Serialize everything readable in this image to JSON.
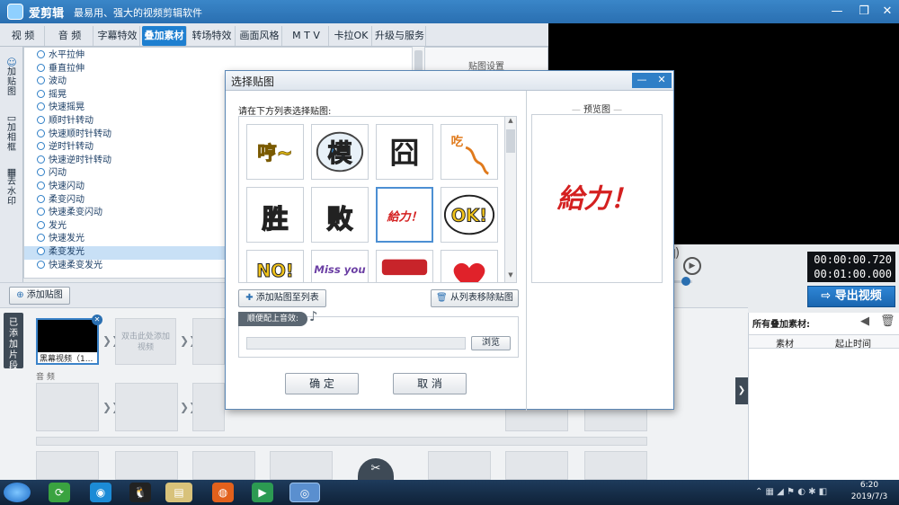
{
  "app": {
    "title": "爱剪辑",
    "subtitle": "最易用、强大的视频剪辑软件"
  },
  "window_controls": {
    "minimize": "—",
    "restore": "❐",
    "close": "✕"
  },
  "tabs": [
    {
      "label": "视 频"
    },
    {
      "label": "音 频"
    },
    {
      "label": "字幕特效"
    },
    {
      "label": "叠加素材",
      "active": true
    },
    {
      "label": "转场特效"
    },
    {
      "label": "画面风格"
    },
    {
      "label": "M T V"
    },
    {
      "label": "卡拉OK"
    },
    {
      "label": "升级与服务"
    }
  ],
  "left_tabs": [
    {
      "label": "加贴图"
    },
    {
      "label": "加相框"
    },
    {
      "label": "去水印"
    }
  ],
  "effects": [
    "水平拉伸",
    "垂直拉伸",
    "波动",
    "摇晃",
    "快速摇晃",
    "顺时针转动",
    "快速顺时针转动",
    "逆时针转动",
    "快速逆时针转动",
    "闪动",
    "快速闪动",
    "柔变闪动",
    "快速柔变闪动",
    "发光",
    "快速发光",
    "柔变发光",
    "快速柔变发光"
  ],
  "selected_effect": "柔变发光",
  "settings_panel": {
    "title": "贴图设置"
  },
  "add_sticker_button": "添加贴图",
  "player": {
    "time_current": "00:00:00.720",
    "time_total": "00:01:00.000"
  },
  "export_button": "导出视频",
  "timeline": {
    "added_tab": "已添加片段",
    "clip_label": "黑幕视频（1...",
    "add_video_hint": "双击此处添加视频",
    "audio_label": "音 频"
  },
  "right_panel": {
    "title": "所有叠加素材:",
    "col_material": "素材",
    "col_start": "起止时间"
  },
  "dialog": {
    "title": "选择贴图",
    "instruction": "请在下方列表选择贴图:",
    "preview_title": "预览图",
    "preview_text": "給力！",
    "add_to_list": "添加贴图至列表",
    "remove_from_list": "从列表移除贴图",
    "audio_title": "顺便配上音效:",
    "browse": "浏览",
    "ok": "确 定",
    "cancel": "取 消",
    "stickers": [
      {
        "name": "sticker-heng",
        "text": "哼~",
        "color": "#e6c21a"
      },
      {
        "name": "sticker-mo",
        "text": "模",
        "color": "#3a8fd8"
      },
      {
        "name": "sticker-jiong",
        "text": "囧",
        "color": "#222222"
      },
      {
        "name": "sticker-chi",
        "text": "吃",
        "color": "#e07a1c"
      },
      {
        "name": "sticker-sheng",
        "text": "胜",
        "color": "#f1d11d"
      },
      {
        "name": "sticker-bai",
        "text": "败",
        "color": "#f1d11d"
      },
      {
        "name": "sticker-geili",
        "text": "給力！",
        "color": "#d42020",
        "selected": true
      },
      {
        "name": "sticker-ok",
        "text": "OK!",
        "color": "#f1c319"
      },
      {
        "name": "sticker-no",
        "text": "NO!",
        "color": "#f1c319"
      },
      {
        "name": "sticker-miss",
        "text": "Miss you",
        "color": "#6b3fa4"
      },
      {
        "name": "sticker-red-banner",
        "text": "",
        "color": "#c8242a"
      },
      {
        "name": "sticker-heart",
        "text": "",
        "color": "#e0222a"
      }
    ]
  },
  "taskbar": {
    "clock_time": "6:20",
    "clock_date": "2019/7/3"
  },
  "colors": {
    "accent": "#1e7fd0",
    "titlebar": "#2a6fb1",
    "selection": "#c8e0f6"
  }
}
